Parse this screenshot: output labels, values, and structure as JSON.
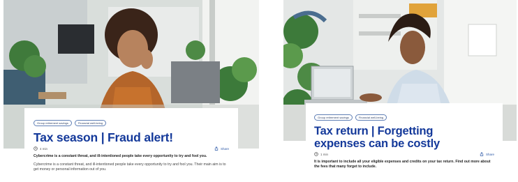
{
  "cards": [
    {
      "tags": [
        "Group retirement savings",
        "Financial well-being"
      ],
      "title": "Tax season | Fraud alert!",
      "read_time": "4 min",
      "share_label": "Share",
      "lead": "Cybercrime is a constant threat, and ill-intentioned people take every opportunity to try and fool you.",
      "body": "Cybercrime is a constant threat, and ill-intentioned people take every opportunity to try and fool you. Their main aim is to get money or personal information out of you."
    },
    {
      "tags": [
        "Group retirement savings",
        "Financial well-being"
      ],
      "title_line1": "Tax return | Forgetting",
      "title_line2": "expenses can be costly",
      "read_time": "1 min",
      "share_label": "Share",
      "lead": "It is important to include all your eligible expenses and credits on your tax return. Find out more about the fees that many forget to include."
    }
  ],
  "colors": {
    "title": "#14399a",
    "tag_border": "#5f7fb5",
    "share": "#2f5aa8"
  },
  "icons": [
    "clock-icon",
    "share-icon"
  ]
}
